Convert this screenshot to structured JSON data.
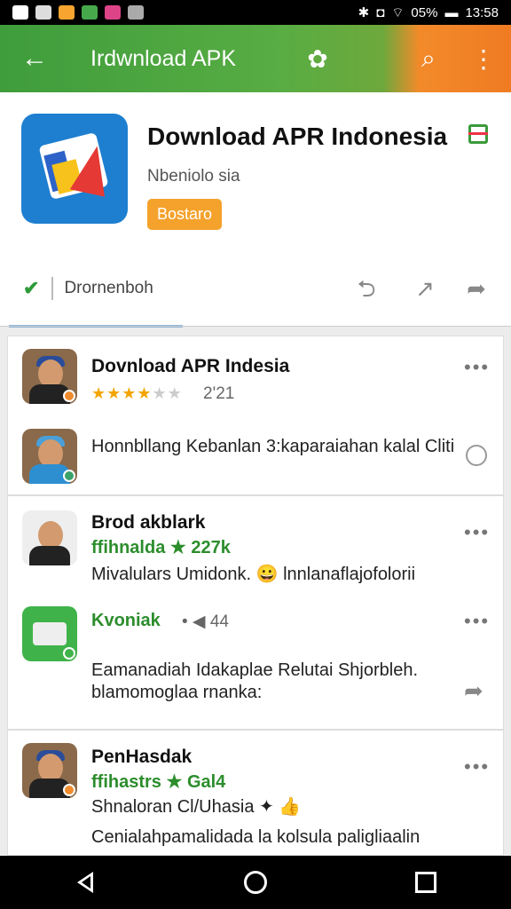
{
  "status": {
    "time": "13:58",
    "battery": "05%"
  },
  "appbar": {
    "title": "Irdwnload APK",
    "back_icon": "arrow-back-icon",
    "search_icon": "search-icon",
    "more_icon": "more-vert-icon"
  },
  "hero": {
    "title": "Download APR Indonesia",
    "subtitle": "Nbeniolo sia",
    "badge": "Bostaro",
    "download_label": "Drornenboh"
  },
  "items": [
    {
      "name": "Dovnload APR Indesia",
      "stars": "★★★★",
      "stars_off": "★★",
      "count": "2'21",
      "text": "Honnbllang Kebanlan 3:kaparaiahan kalal Cliti"
    },
    {
      "name": "Brod akblark",
      "meta": "ffihnalda ★ 227k",
      "text": "Mivalulars Umidonk. 😀 lnnlanaflajofolorii"
    },
    {
      "name": "Kvoniak",
      "meta": "• ◀ 44",
      "text": "Eamanadiah Idakaplae Relutai Shjorbleh. blamomoglaa rnanka:"
    },
    {
      "name": "PenHasdak",
      "meta": "ffihastrs ★ Gal4",
      "text1": "Shnaloran Cl/Uhasia ✦ 👍",
      "text2": "Cenialahpamalidada la kolsula paligliaalin"
    }
  ],
  "colors": {
    "accent_green": "#3f9d3c",
    "accent_orange": "#f07b22",
    "star": "#f4a400"
  }
}
